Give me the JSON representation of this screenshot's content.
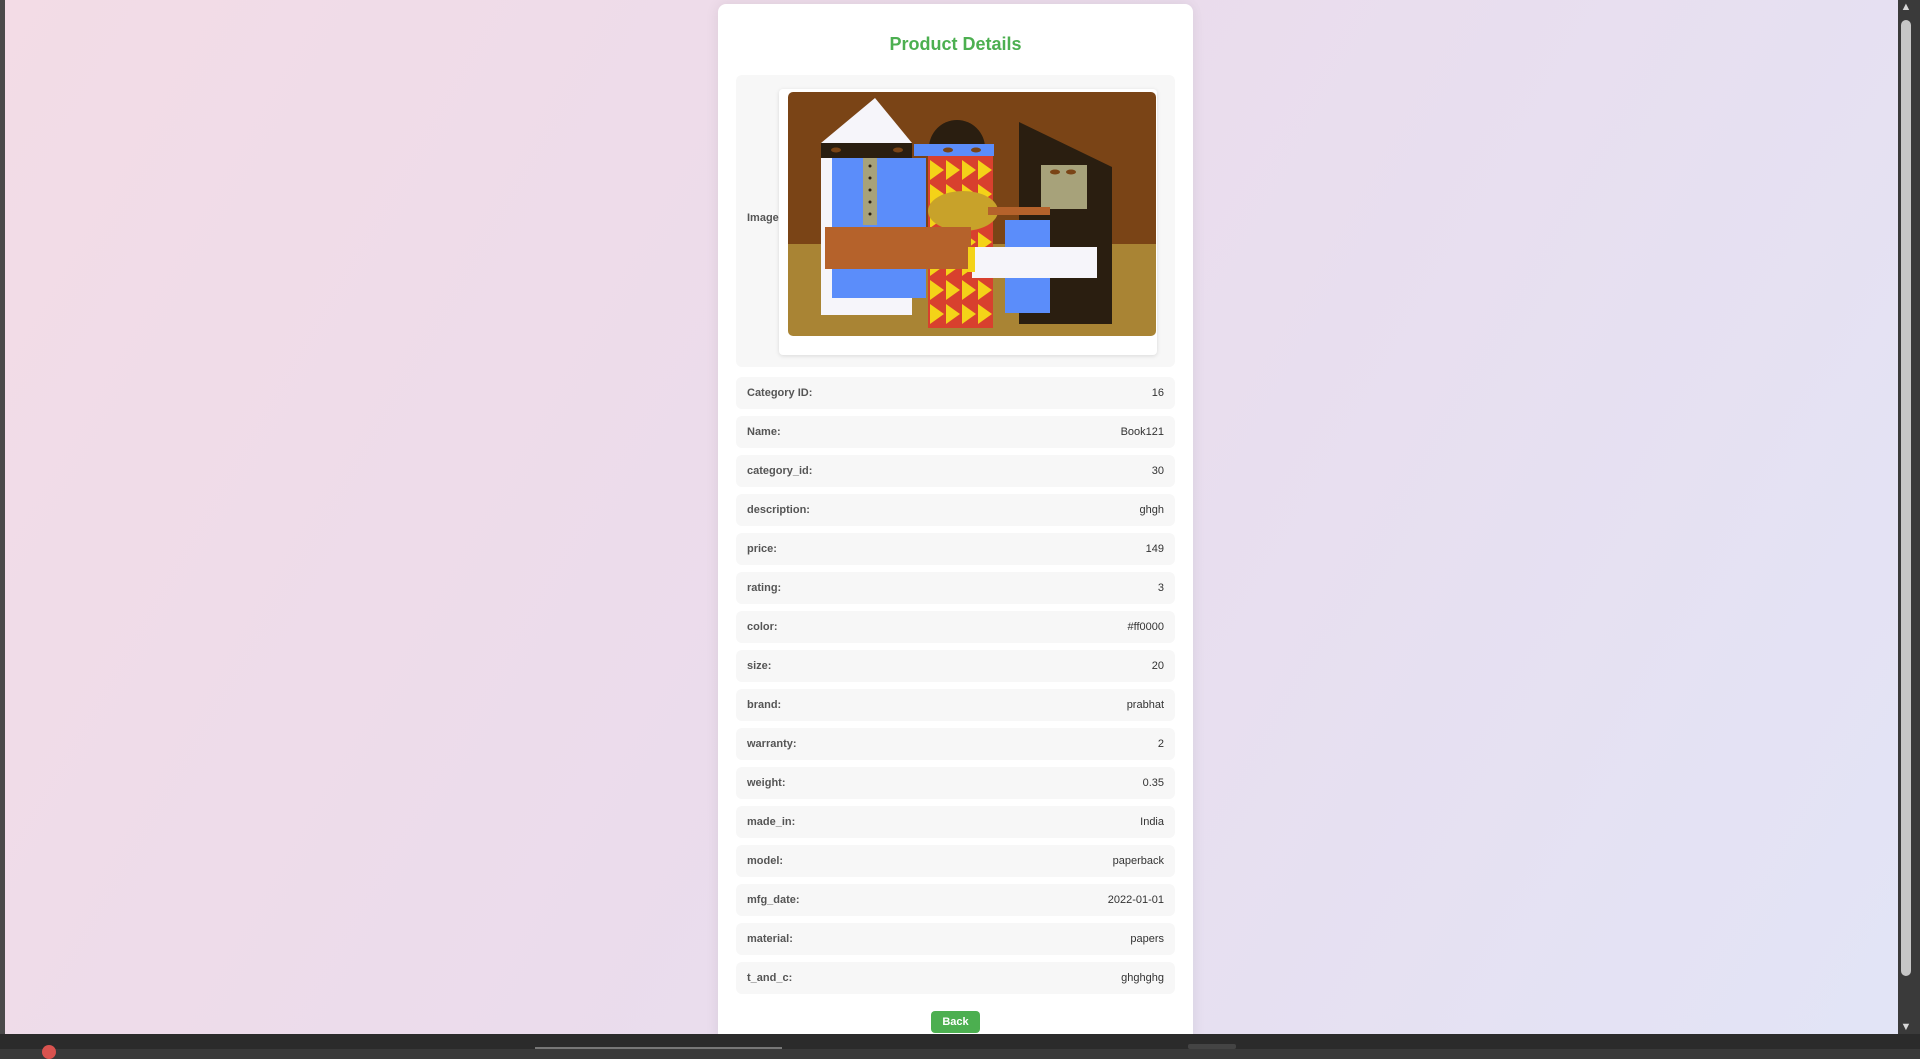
{
  "page": {
    "title": "Product Details",
    "image_label": "Image:",
    "back_label": "Back"
  },
  "fields": [
    {
      "label": "Category ID:",
      "value": "16"
    },
    {
      "label": "Name:",
      "value": "Book121"
    },
    {
      "label": "category_id:",
      "value": "30"
    },
    {
      "label": "description:",
      "value": "ghgh"
    },
    {
      "label": "price:",
      "value": "149"
    },
    {
      "label": "rating:",
      "value": "3"
    },
    {
      "label": "color:",
      "value": "#ff0000"
    },
    {
      "label": "size:",
      "value": "20"
    },
    {
      "label": "brand:",
      "value": "prabhat"
    },
    {
      "label": "warranty:",
      "value": "2"
    },
    {
      "label": "weight:",
      "value": "0.35"
    },
    {
      "label": "made_in:",
      "value": "India"
    },
    {
      "label": "model:",
      "value": "paperback"
    },
    {
      "label": "mfg_date:",
      "value": "2022-01-01"
    },
    {
      "label": "material:",
      "value": "papers"
    },
    {
      "label": "t_and_c:",
      "value": "ghghghg"
    }
  ],
  "colors": {
    "accent": "#4caf50",
    "row_background": "#f7f7f7"
  },
  "icons": {
    "scroll_up": "triangle-up-icon",
    "scroll_down": "triangle-down-icon"
  }
}
